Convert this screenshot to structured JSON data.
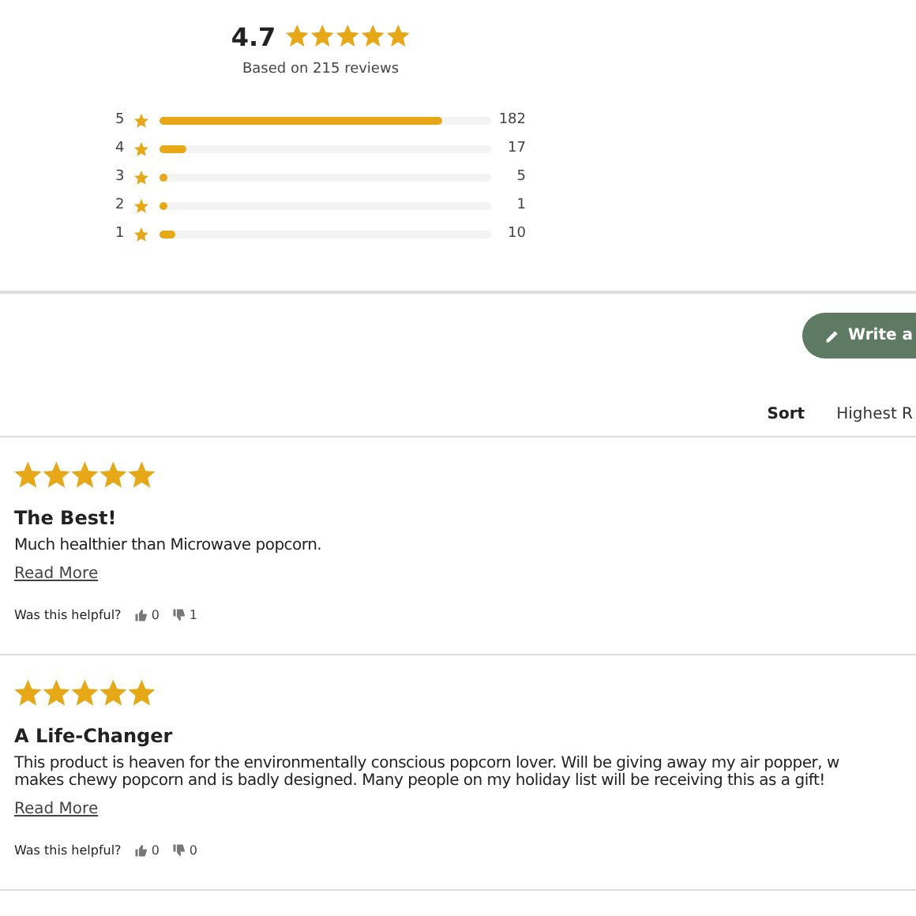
{
  "summary": {
    "average": "4.7",
    "stars": 5,
    "based_on": "Based on 215 reviews"
  },
  "distribution": [
    {
      "label": "5",
      "level": 0.85,
      "count": "182"
    },
    {
      "label": "4",
      "level": 0.08,
      "count": "17"
    },
    {
      "label": "3",
      "level": 0.023,
      "count": "5"
    },
    {
      "label": "2",
      "level": 0.005,
      "count": "1"
    },
    {
      "label": "1",
      "level": 0.047,
      "count": "10"
    }
  ],
  "write_button": {
    "label": "Write a"
  },
  "sort": {
    "label": "Sort",
    "value": "Highest R"
  },
  "reviews": [
    {
      "stars": 5,
      "title": "The Best!",
      "body_lines": [
        "Much healthier than Microwave popcorn."
      ],
      "read_more": "Read More",
      "helpful_label": "Was this helpful?",
      "up": "0",
      "down": "1"
    },
    {
      "stars": 5,
      "title": "A Life-Changer",
      "body_lines": [
        "This product is heaven for the environmentally conscious popcorn lover. Will be giving away my air popper, w",
        "makes chewy popcorn and is badly designed. Many people on my holiday list will be receiving this as a gift!"
      ],
      "read_more": "Read More",
      "helpful_label": "Was this helpful?",
      "up": "0",
      "down": "0"
    }
  ]
}
